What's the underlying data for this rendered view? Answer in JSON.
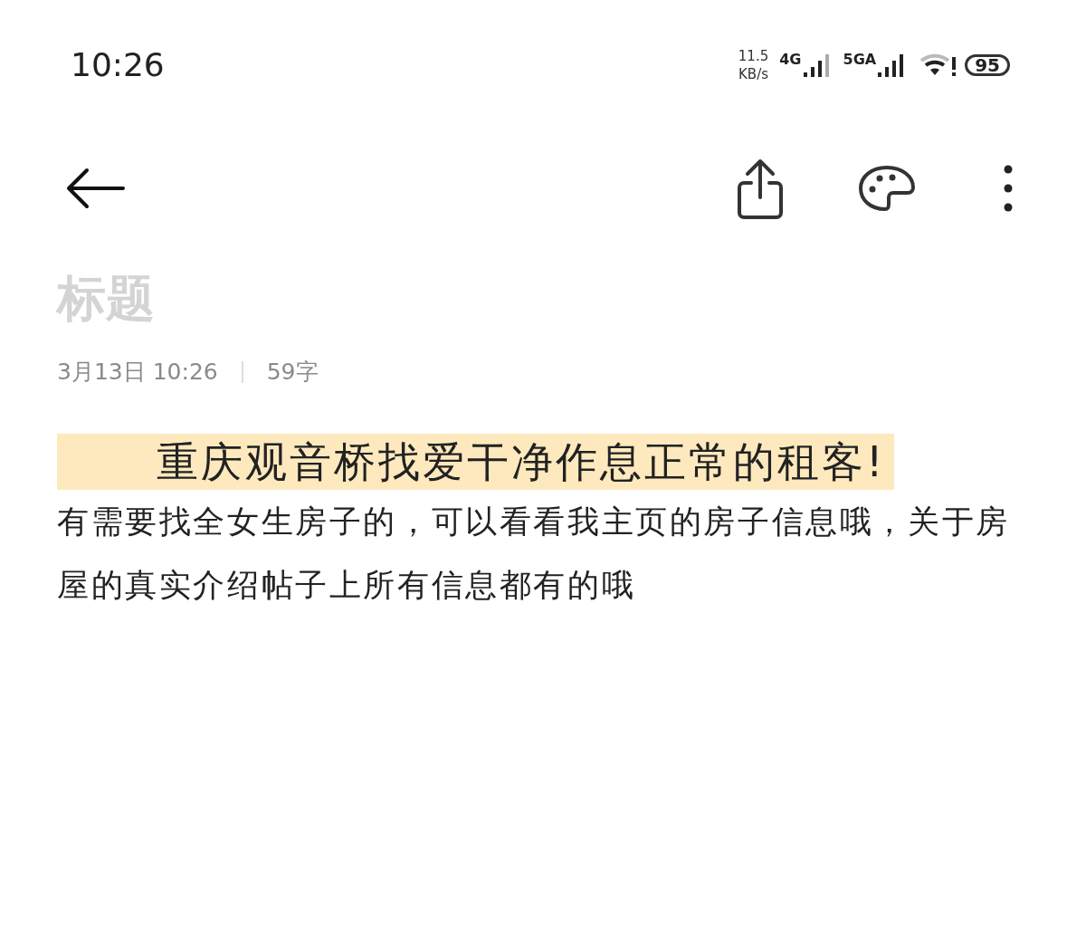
{
  "status_bar": {
    "time": "10:26",
    "net_speed": "11.5",
    "net_unit": "KB/s",
    "sim1": "4G",
    "sim2": "5GA",
    "battery": "95"
  },
  "note": {
    "title": {
      "placeholder": "标题"
    },
    "date": "3月13日 10:26",
    "word_count": "59字",
    "heading": "重庆观音桥找爱干净作息正常的租客!",
    "body": "有需要找全女生房子的，可以看看我主页的房子信息哦，关于房屋的真实介绍帖子上所有信息都有的哦"
  }
}
